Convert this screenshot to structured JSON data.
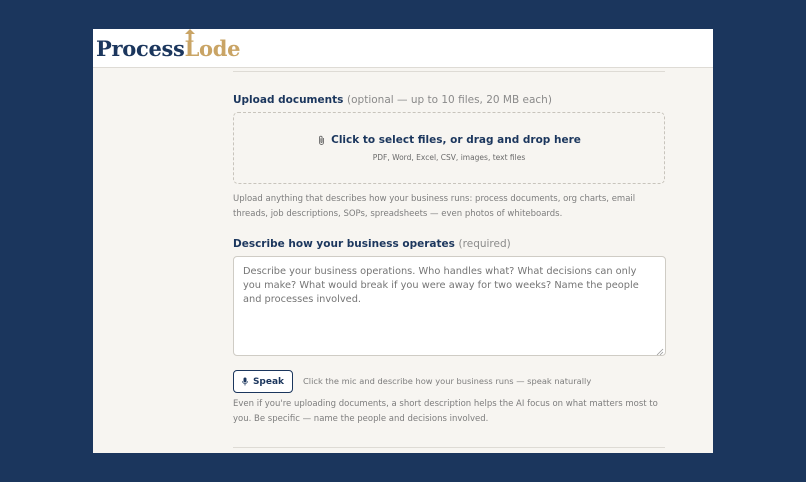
{
  "brand": {
    "logo_part1": "Process",
    "logo_part2": "Lode",
    "primary_color": "#1b365d",
    "accent_color": "#c9a465"
  },
  "upload": {
    "label": "Upload documents",
    "label_hint": "(optional — up to 10 files, 20 MB each)",
    "dropzone_title": "Click to select files, or drag and drop here",
    "dropzone_icon": "paperclip-icon",
    "dropzone_subtitle": "PDF, Word, Excel, CSV, images, text files",
    "help_text": "Upload anything that describes how your business runs: process documents, org charts, email threads, job descriptions, SOPs, spreadsheets — even photos of whiteboards."
  },
  "describe": {
    "label": "Describe how your business operates",
    "label_hint": "(required)",
    "placeholder": "Describe your business operations. Who handles what? What decisions can only you make? What would break if you were away for two weeks? Name the people and processes involved.",
    "speak_button": "Speak",
    "speak_icon": "microphone-icon",
    "speak_hint": "Click the mic and describe how your business runs — speak naturally",
    "help_text": "Even if you're uploading documents, a short description helps the AI focus on what matters most to you. Be specific — name the people and decisions involved."
  }
}
